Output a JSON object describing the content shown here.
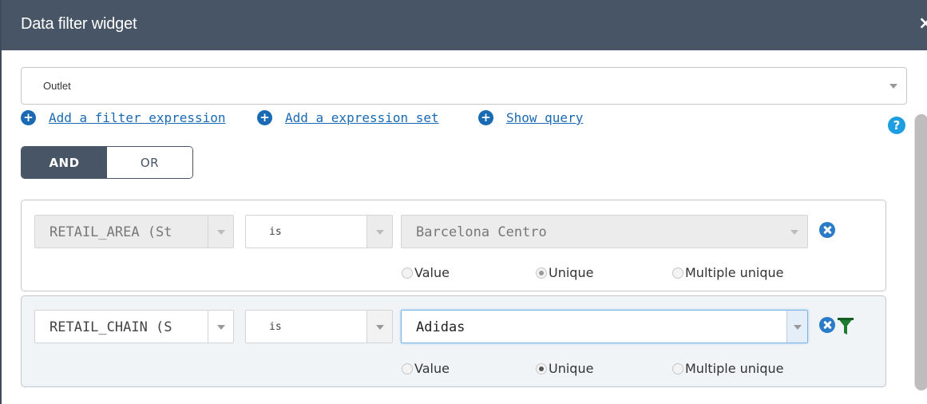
{
  "window": {
    "title": "Data filter widget",
    "close_glyph": "×"
  },
  "layer_select": {
    "value": "Outlet"
  },
  "links": {
    "add_filter_expression": "Add a filter expression",
    "add_expression_set": "Add a expression set",
    "show_query": "Show query"
  },
  "help_glyph": "?",
  "logic": {
    "and_label": "AND",
    "or_label": "OR",
    "selected": "AND"
  },
  "expressions": [
    {
      "field": "RETAIL_AREA (St",
      "operator": "is",
      "value": "Barcelona Centro",
      "disabled": true,
      "radio_options": [
        "Value",
        "Unique",
        "Multiple unique"
      ],
      "selected_option": "Unique"
    },
    {
      "field": "RETAIL_CHAIN (S",
      "operator": "is",
      "value": "Adidas",
      "disabled": false,
      "radio_options": [
        "Value",
        "Unique",
        "Multiple unique"
      ],
      "selected_option": "Unique"
    }
  ],
  "icons": {
    "plus": "plus-circle-icon",
    "remove": "remove-circle-icon",
    "filter": "filter-funnel-icon",
    "help": "help-icon"
  },
  "colors": {
    "titlebar": "#485566",
    "link": "#1a6ab3",
    "accent": "#2a7bc8",
    "help": "#1c9ee0",
    "filter_icon": "#1e7a2e"
  }
}
